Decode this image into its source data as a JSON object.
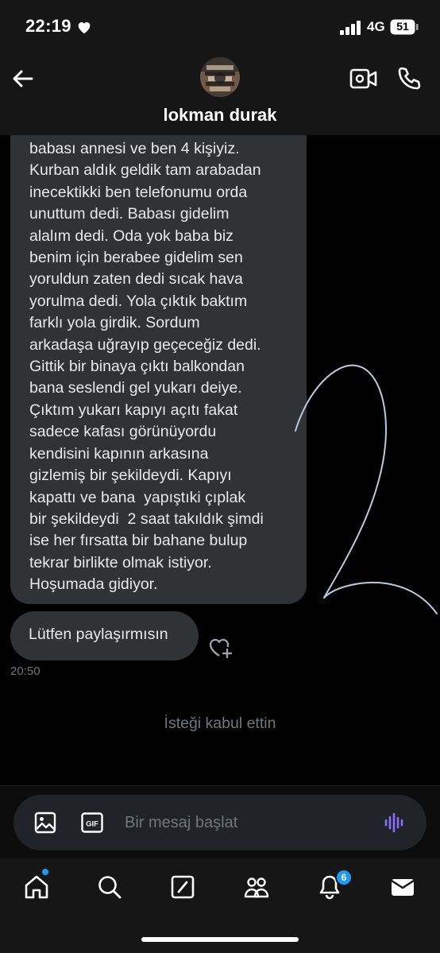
{
  "status_bar": {
    "time": "22:19",
    "network": "4G",
    "battery": "51"
  },
  "header": {
    "contact_name": "lokman durak"
  },
  "messages": [
    {
      "text": "babası annesi ve ben 4 kişiyiz.\nKurban aldık geldik tam arabadan\ninecektikki ben telefonumu orda\nunuttum dedi. Babası gidelim\nalalım dedi. Oda yok baba biz\nbenim için berabee gidelim sen\nyoruldun zaten dedi sıcak hava\nyorulma dedi. Yola çıktık baktım\nfarklı yola girdik. Sordum\narkadaşa uğrayıp geçeceğiz dedi.\nGittik bir binaya çıktı balkondan\nbana seslendi gel yukarı deiye.\nÇıktım yukarı kapıyı açıtı fakat\nsadece kafası görünüyordu\nkendisini kapının arkasına\ngizlemiş bir şekildeydi. Kapıyı\nkapattı ve bana  yapıştıki çıplak\nbir şekildeydi  2 saat takıldık şimdi\nise her fırsatta bir bahane bulup\ntekrar birlikte olmak istiyor.\nHoşumada gidiyor."
    },
    {
      "text": "Lütfen paylaşırmısın",
      "time": "20:50"
    }
  ],
  "system_note": "İsteği kabul ettin",
  "composer": {
    "placeholder": "Bir mesaj başlat",
    "gif_label": "GIF"
  },
  "nav": {
    "items": [
      "home-icon",
      "search-icon",
      "grok-icon",
      "communities-icon",
      "notifications-icon",
      "messages-icon"
    ],
    "notifications_badge": "6"
  },
  "colors": {
    "accent": "#1d9bf0",
    "bubble": "#2f3336",
    "muted_text": "#71767b",
    "voice_icon": "#8b6cff"
  }
}
